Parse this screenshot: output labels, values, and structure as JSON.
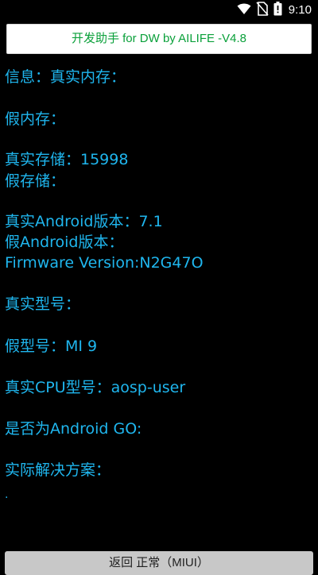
{
  "status_bar": {
    "time": "9:10",
    "icons": [
      "wifi-icon",
      "no-sim-icon",
      "battery-icon"
    ]
  },
  "header": {
    "title": "开发助手 for DW by AILIFE -V4.8",
    "title_color": "#0aa03a"
  },
  "info": {
    "text_color": "#1fb6ee",
    "lines": [
      "信息：真实内存：",
      "假内存：",
      "真实存储：15998",
      "假存储：",
      "真实Android版本：7.1",
      "假Android版本：",
      "Firmware Version:N2G47O",
      "真实型号：",
      "假型号：MI 9",
      "真实CPU型号：aosp-user",
      "是否为Android GO:",
      "实际解决方案："
    ],
    "trailing_mark": "."
  },
  "footer": {
    "button_label": "返回 正常（MIUI）"
  }
}
